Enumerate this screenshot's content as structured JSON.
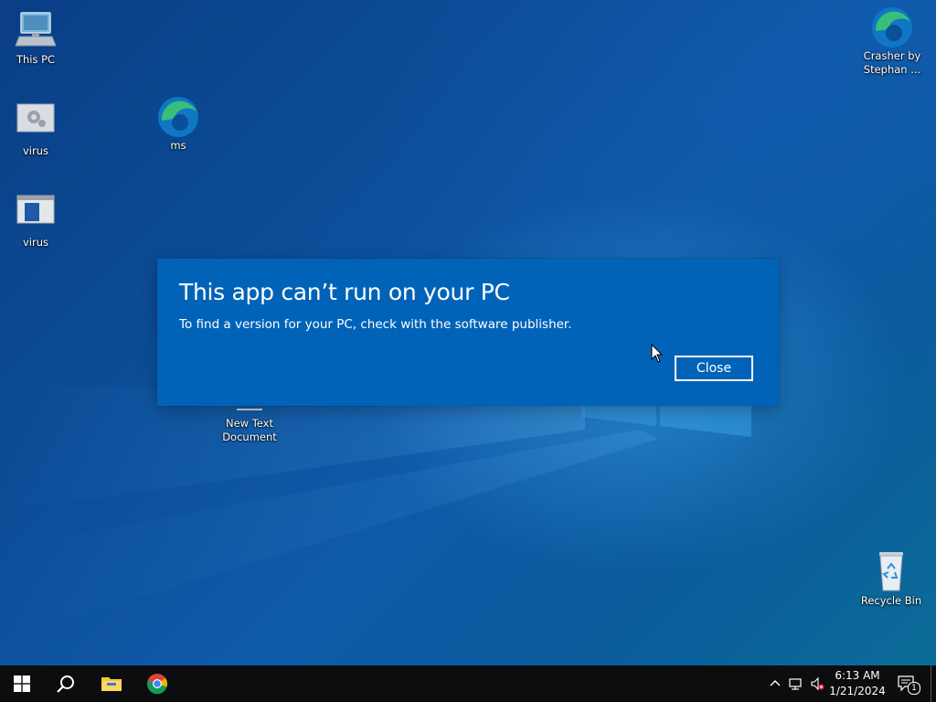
{
  "desktop": {
    "icons": {
      "this_pc": "This PC",
      "virus1": "virus",
      "virus2": "virus",
      "ms": "ms",
      "crasher": "Crasher by Stephan ...",
      "new_text_doc": "New Text Document",
      "recycle_bin": "Recycle Bin"
    }
  },
  "dialog": {
    "title": "This app can’t run on your PC",
    "message": "To find a version for your PC, check with the software publisher.",
    "close_label": "Close"
  },
  "taskbar": {
    "apps": [
      "start-icon",
      "search-icon",
      "file-explorer-icon",
      "chrome-icon"
    ],
    "clock": {
      "time": "6:13 AM",
      "date": "1/21/2024"
    },
    "notification_count": "1"
  },
  "colors": {
    "dialog_bg": "#0063b8",
    "taskbar_bg": "#0c0d0f",
    "desktop_accent": "#0f5aa8"
  }
}
